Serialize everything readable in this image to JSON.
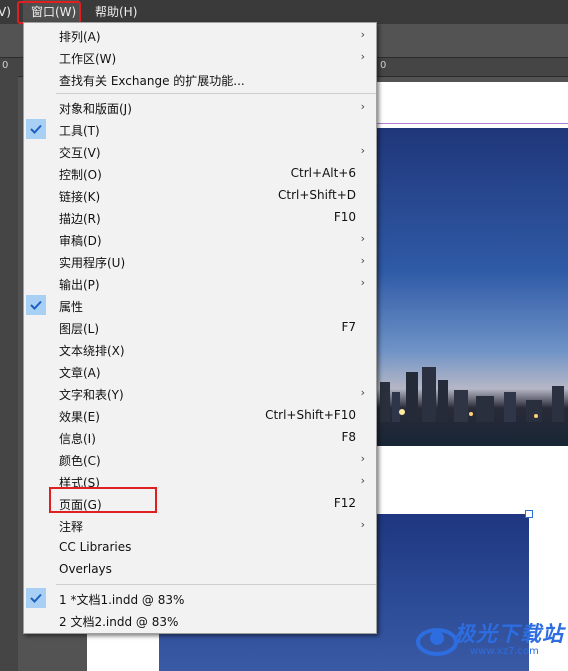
{
  "menubar": {
    "partial_item": "V)",
    "window_menu": "窗口(W)",
    "help_menu": "帮助(H)"
  },
  "ruler": {
    "ticks": [
      "0",
      "0"
    ]
  },
  "window_menu_items": [
    {
      "label": "排列(A)",
      "shortcut": "",
      "submenu": true,
      "checked": false
    },
    {
      "label": "工作区(W)",
      "shortcut": "",
      "submenu": true,
      "checked": false
    },
    {
      "label": "查找有关 Exchange 的扩展功能...",
      "shortcut": "",
      "submenu": false,
      "checked": false
    },
    {
      "label": "对象和版面(J)",
      "shortcut": "",
      "submenu": true,
      "checked": false
    },
    {
      "label": "工具(T)",
      "shortcut": "",
      "submenu": false,
      "checked": true
    },
    {
      "label": "交互(V)",
      "shortcut": "",
      "submenu": true,
      "checked": false
    },
    {
      "label": "控制(O)",
      "shortcut": "Ctrl+Alt+6",
      "submenu": false,
      "checked": false
    },
    {
      "label": "链接(K)",
      "shortcut": "Ctrl+Shift+D",
      "submenu": false,
      "checked": false
    },
    {
      "label": "描边(R)",
      "shortcut": "F10",
      "submenu": false,
      "checked": false
    },
    {
      "label": "审稿(D)",
      "shortcut": "",
      "submenu": true,
      "checked": false
    },
    {
      "label": "实用程序(U)",
      "shortcut": "",
      "submenu": true,
      "checked": false
    },
    {
      "label": "输出(P)",
      "shortcut": "",
      "submenu": true,
      "checked": false
    },
    {
      "label": "属性",
      "shortcut": "",
      "submenu": false,
      "checked": true
    },
    {
      "label": "图层(L)",
      "shortcut": "F7",
      "submenu": false,
      "checked": false
    },
    {
      "label": "文本绕排(X)",
      "shortcut": "",
      "submenu": false,
      "checked": false
    },
    {
      "label": "文章(A)",
      "shortcut": "",
      "submenu": false,
      "checked": false
    },
    {
      "label": "文字和表(Y)",
      "shortcut": "",
      "submenu": true,
      "checked": false
    },
    {
      "label": "效果(E)",
      "shortcut": "Ctrl+Shift+F10",
      "submenu": false,
      "checked": false
    },
    {
      "label": "信息(I)",
      "shortcut": "F8",
      "submenu": false,
      "checked": false
    },
    {
      "label": "颜色(C)",
      "shortcut": "",
      "submenu": true,
      "checked": false
    },
    {
      "label": "样式(S)",
      "shortcut": "",
      "submenu": true,
      "checked": false
    },
    {
      "label": "页面(G)",
      "shortcut": "F12",
      "submenu": false,
      "checked": false
    },
    {
      "label": "注释",
      "shortcut": "",
      "submenu": true,
      "checked": false
    },
    {
      "label": "CC Libraries",
      "shortcut": "",
      "submenu": false,
      "checked": false
    },
    {
      "label": "Overlays",
      "shortcut": "",
      "submenu": false,
      "checked": false
    },
    {
      "label": "1 *文档1.indd @ 83%",
      "shortcut": "",
      "submenu": false,
      "checked": true
    },
    {
      "label": "2 文档2.indd @ 83%",
      "shortcut": "",
      "submenu": false,
      "checked": false
    }
  ],
  "watermark": {
    "text": "极光下载站",
    "url": "www.xz7.com"
  },
  "colors": {
    "highlight_border": "#e02020",
    "check_bg": "#a8d0f5",
    "menu_bg": "#f2f2f2"
  }
}
